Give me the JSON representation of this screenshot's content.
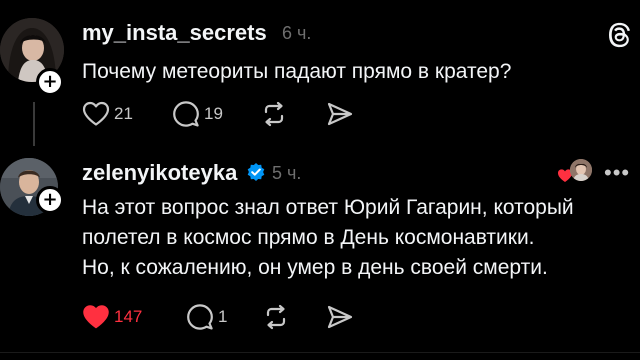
{
  "posts": [
    {
      "username": "my_insta_secrets",
      "time": "6 ч.",
      "text_lines": [
        "Почему метеориты падают прямо в кратер?"
      ],
      "likes": "21",
      "comments": "19",
      "liked": false
    },
    {
      "username": "zelenyikoteyka",
      "verified": true,
      "time": "5 ч.",
      "text_lines": [
        "На этот вопрос знал ответ Юрий Гагарин, который",
        "полетел в космос прямо в День космонавтики.",
        "Но, к сожалению, он умер в день своей смерти."
      ],
      "likes": "147",
      "comments": "1",
      "liked": true
    }
  ],
  "icons": {
    "top_right": "threads-logo-icon",
    "more": "more-dots-icon",
    "like": "heart-icon",
    "comment": "comment-bubble-icon",
    "repost": "repost-icon",
    "share": "send-icon",
    "verified": "verified-badge-icon",
    "follow": "plus-icon"
  },
  "colors": {
    "background": "#000000",
    "text": "#f3f5f7",
    "muted": "#6e6e6e",
    "like_red": "#ff3040",
    "verified_blue": "#0095f6"
  }
}
